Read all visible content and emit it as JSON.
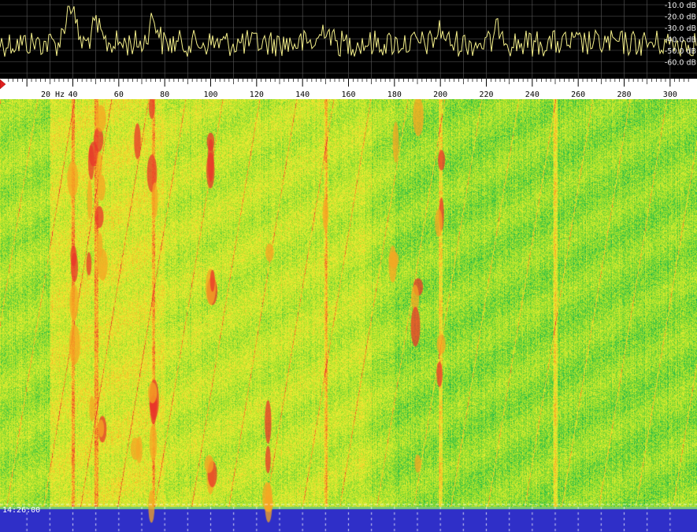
{
  "spectrum": {
    "db_labels": [
      "-10.0 dB",
      "-20.0 dB",
      "-30.0 dB",
      "-40.0 dB",
      "-50.0 dB",
      "-60.0 dB"
    ],
    "trace_color": "#f5f08a",
    "grid_color": "#5a5a5a"
  },
  "scale": {
    "unit_label": "20 Hz",
    "freq_ticks": [
      "40",
      "60",
      "80",
      "100",
      "120",
      "140",
      "160",
      "180",
      "200",
      "220",
      "240",
      "260",
      "280",
      "300"
    ],
    "range_hz": [
      10,
      310
    ]
  },
  "waterfall": {
    "timestamp": "14:26:00",
    "noise_floor_color": "#2f2fc8",
    "strong_line_hz": [
      40,
      50,
      75,
      150,
      200,
      250
    ],
    "palette": [
      "#1f2fd0",
      "#19b84a",
      "#9ee02a",
      "#eeee33",
      "#f5a623",
      "#e8362a"
    ]
  }
}
